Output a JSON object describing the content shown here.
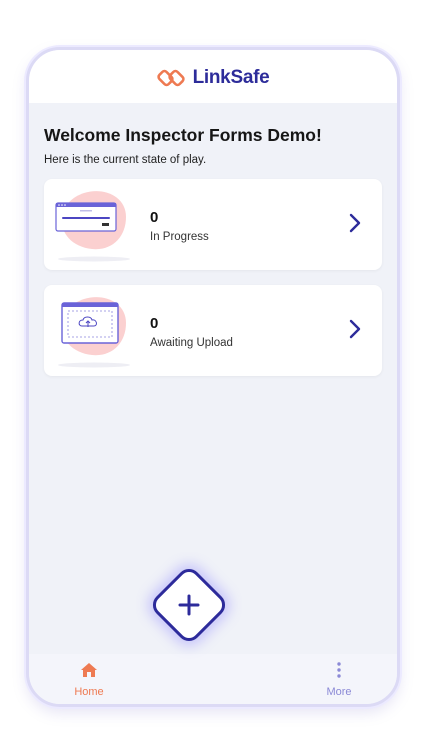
{
  "app": {
    "brand": "LinkSafe"
  },
  "home": {
    "welcome": "Welcome Inspector Forms Demo!",
    "subtitle": "Here is the current state of play."
  },
  "cards": [
    {
      "count": "0",
      "label": "In Progress",
      "icon": "progress-form-illustration"
    },
    {
      "count": "0",
      "label": "Awaiting Upload",
      "icon": "cloud-upload-illustration"
    }
  ],
  "nav": {
    "home_label": "Home",
    "more_label": "More",
    "fab_icon": "plus-icon"
  },
  "colors": {
    "brand_navy": "#2d2c9a",
    "accent_orange": "#ee7a52",
    "nav_inactive": "#8b89d6",
    "background": "#f0f2f8",
    "blob_pink": "#fbd0d0"
  }
}
